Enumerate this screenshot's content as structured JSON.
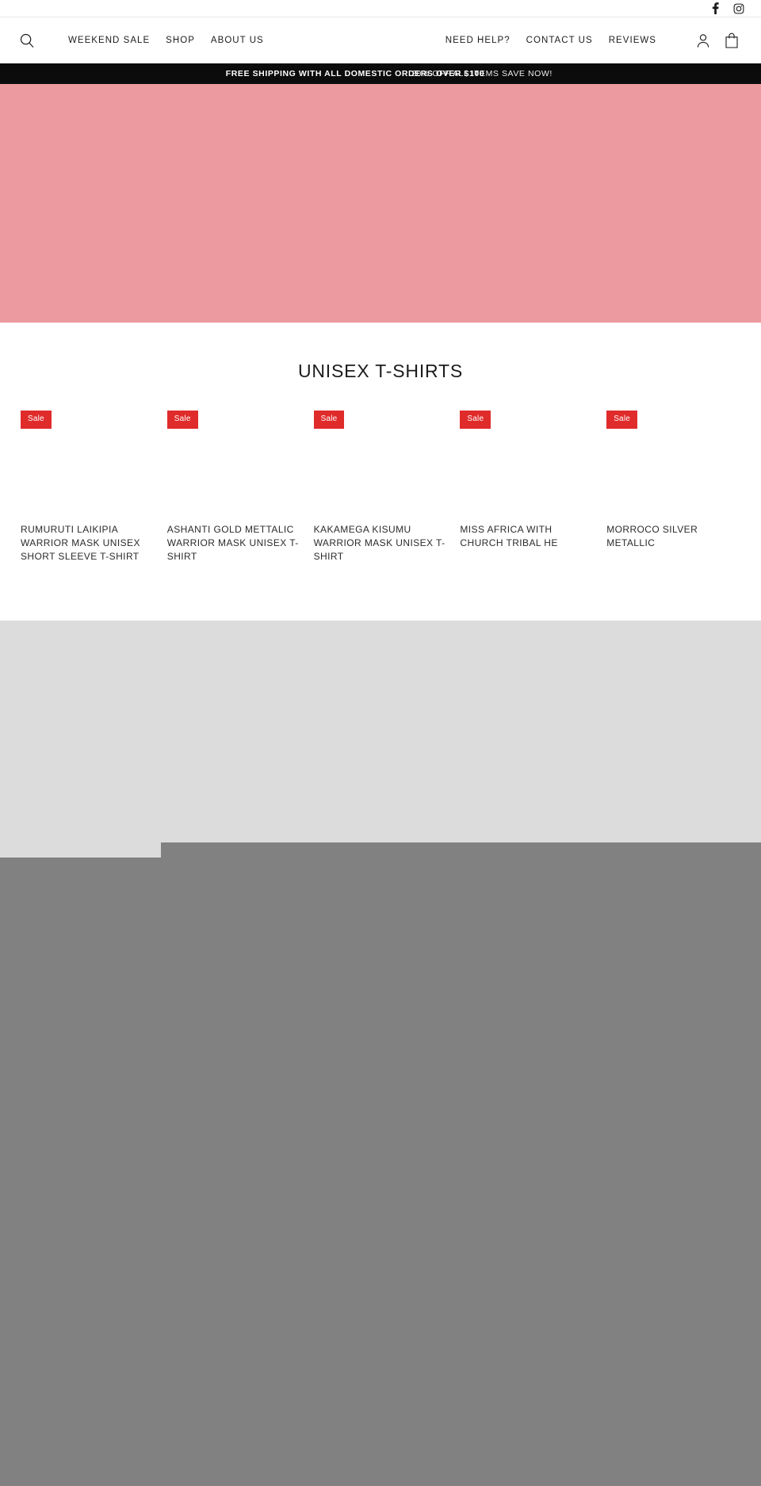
{
  "topbar": {
    "social": [
      {
        "name": "facebook-icon",
        "label": "Facebook"
      },
      {
        "name": "instagram-icon",
        "label": "Instagram"
      }
    ]
  },
  "header": {
    "search_label": "Search",
    "nav_left": [
      {
        "label": "WEEKEND SALE"
      },
      {
        "label": "SHOP"
      },
      {
        "label": "ABOUT US"
      }
    ],
    "nav_right": [
      {
        "label": "NEED HELP?"
      },
      {
        "label": "CONTACT US"
      },
      {
        "label": "REVIEWS"
      }
    ],
    "icons": [
      {
        "name": "account-icon",
        "label": "Log in"
      },
      {
        "name": "cart-icon",
        "label": "Cart"
      }
    ]
  },
  "announcement": {
    "primary": "FREE SHIPPING WITH ALL DOMESTIC ORDERS OVER $100",
    "secondary": "20% OFF ALL ITEMS SAVE NOW!",
    "background": "#0c0c0c"
  },
  "hero": {
    "background": "#ec9aa0"
  },
  "collection": {
    "title": "UNISEX T-SHIRTS",
    "badge_label": "Sale",
    "badge_color": "#e02b2b",
    "products": [
      {
        "title": "RUMURUTI LAIKIPIA WARRIOR MASK UNISEX SHORT SLEEVE T-SHIRT",
        "badge": "Sale"
      },
      {
        "title": "ASHANTI GOLD METTALIC WARRIOR MASK UNISEX T-SHIRT",
        "badge": "Sale"
      },
      {
        "title": "KAKAMEGA KISUMU WARRIOR MASK UNISEX T-SHIRT",
        "badge": "Sale"
      },
      {
        "title": "MISS AFRICA WITH CHURCH TRIBAL HE",
        "badge": "Sale"
      },
      {
        "title": "MORROCO SILVER METALLIC",
        "badge": "Sale"
      }
    ]
  },
  "palette": {
    "light_block": "#dcdcdc",
    "gray_block": "#818181"
  }
}
